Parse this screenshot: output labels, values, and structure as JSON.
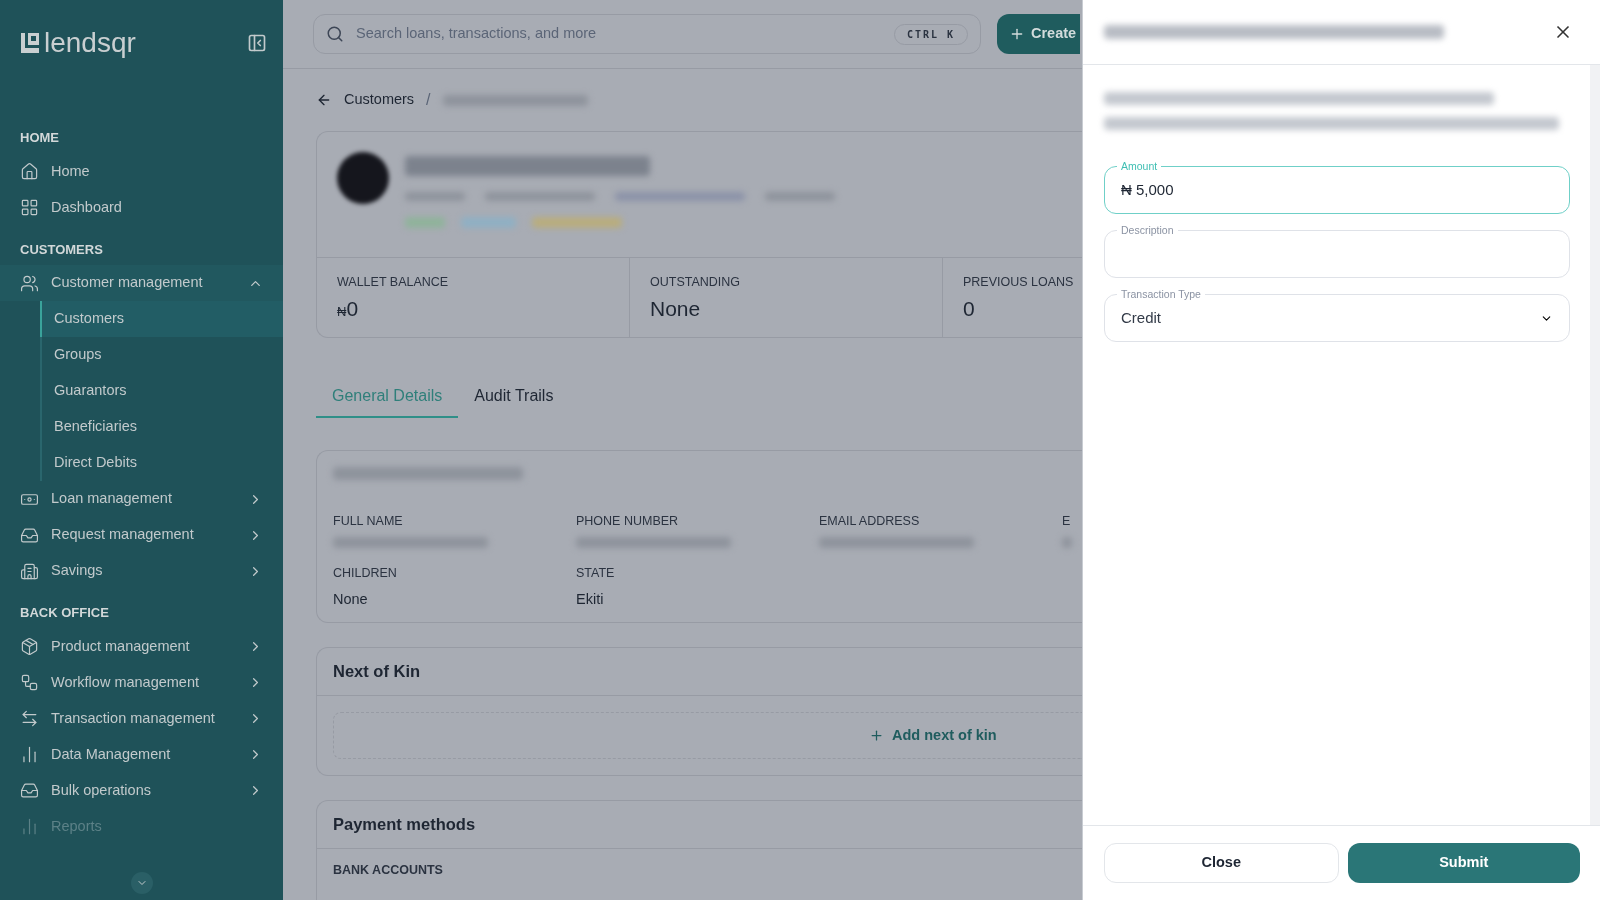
{
  "sidebar": {
    "logo": "lendsqr",
    "sections": [
      {
        "title": "HOME",
        "items": [
          {
            "kind": "link",
            "label": "Home",
            "disabled": false
          },
          {
            "kind": "link",
            "label": "Dashboard",
            "disabled": false
          }
        ]
      },
      {
        "title": "CUSTOMERS",
        "items": [
          {
            "kind": "group",
            "label": "Customer management",
            "expanded": true,
            "disabled": false,
            "children": [
              {
                "label": "Customers",
                "selected": true
              },
              {
                "label": "Groups",
                "selected": false
              },
              {
                "label": "Guarantors",
                "selected": false
              },
              {
                "label": "Beneficiaries",
                "selected": false
              },
              {
                "label": "Direct Debits",
                "selected": false
              }
            ]
          },
          {
            "kind": "group",
            "label": "Loan management",
            "expanded": false,
            "disabled": false
          },
          {
            "kind": "group",
            "label": "Request management",
            "expanded": false,
            "disabled": false
          },
          {
            "kind": "group",
            "label": "Savings",
            "expanded": false,
            "disabled": false
          }
        ]
      },
      {
        "title": "BACK OFFICE",
        "items": [
          {
            "kind": "group",
            "label": "Product management",
            "expanded": false,
            "disabled": false
          },
          {
            "kind": "group",
            "label": "Workflow management",
            "expanded": false,
            "disabled": false
          },
          {
            "kind": "group",
            "label": "Transaction management",
            "expanded": false,
            "disabled": false
          },
          {
            "kind": "group",
            "label": "Data Management",
            "expanded": false,
            "disabled": false
          },
          {
            "kind": "group",
            "label": "Bulk operations",
            "expanded": false,
            "disabled": false
          },
          {
            "kind": "link",
            "label": "Reports",
            "disabled": true
          }
        ]
      }
    ]
  },
  "topbar": {
    "search": {
      "placeholder": "Search loans, transactions, and more",
      "shortcut": "CTRL K"
    },
    "create_button": "Create"
  },
  "breadcrumb": {
    "parent": "Customers",
    "separator": "/"
  },
  "stats": [
    {
      "label": "WALLET BALANCE",
      "currency": "₦",
      "value": "0"
    },
    {
      "label": "OUTSTANDING",
      "value": "None"
    },
    {
      "label": "PREVIOUS LOANS",
      "value": "0"
    }
  ],
  "tabs": [
    {
      "label": "General Details",
      "selected": true
    },
    {
      "label": "Audit Trails",
      "selected": false
    }
  ],
  "personal_info": {
    "fields": [
      {
        "label": "FULL NAME",
        "redacted": true
      },
      {
        "label": "PHONE NUMBER",
        "redacted": true
      },
      {
        "label": "EMAIL ADDRESS",
        "redacted": true
      },
      {
        "label": "E",
        "redacted": true
      },
      {
        "label": "CHILDREN",
        "redacted": false,
        "value": "None"
      },
      {
        "label": "STATE",
        "redacted": false,
        "value": "Ekiti"
      }
    ]
  },
  "next_of_kin": {
    "title": "Next of Kin",
    "add_button": "Add next of kin"
  },
  "payment_methods": {
    "title": "Payment methods",
    "section": "BANK ACCOUNTS"
  },
  "drawer": {
    "fields": [
      {
        "kind": "money",
        "label": "Amount",
        "currency": "₦",
        "value": "5,000",
        "focused": true
      },
      {
        "kind": "text",
        "label": "Description",
        "focused": false
      },
      {
        "kind": "select",
        "label": "Transaction Type",
        "value": "Credit",
        "focused": false
      }
    ],
    "buttons": [
      {
        "kind": "secondary",
        "label": "Close"
      },
      {
        "kind": "primary",
        "label": "Submit"
      }
    ]
  }
}
